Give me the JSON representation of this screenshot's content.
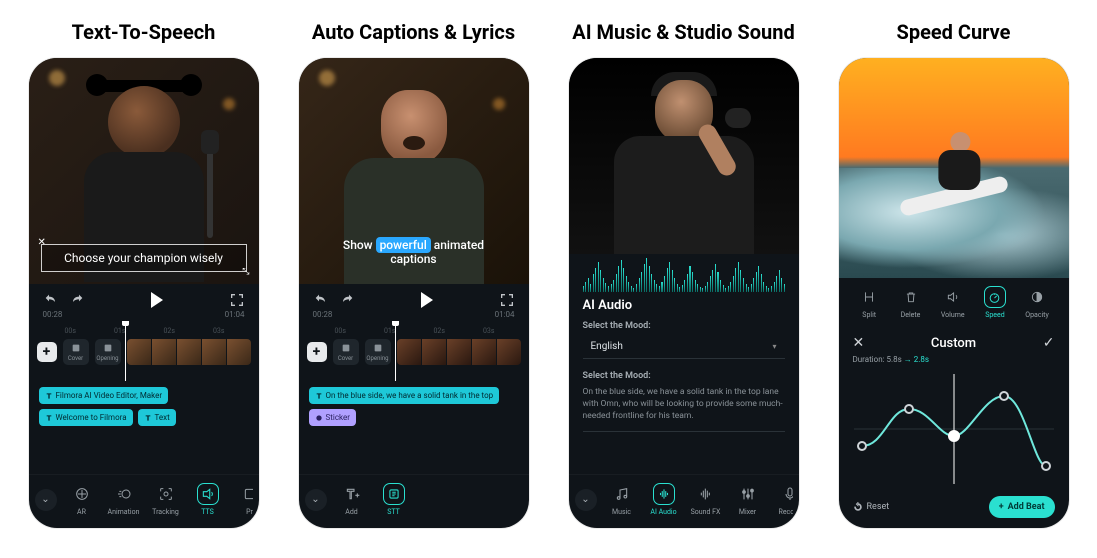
{
  "panels": [
    {
      "title": "Text-To-Speech"
    },
    {
      "title": "Auto Captions & Lyrics"
    },
    {
      "title": "AI Music & Studio Sound"
    },
    {
      "title": "Speed Curve"
    }
  ],
  "phone1": {
    "caption": "Choose your champion wisely",
    "time_left": "00:28",
    "time_right": "01:04",
    "ruler": [
      "00s",
      "01s",
      "02s",
      "03s"
    ],
    "track_tool1": "Cover",
    "track_tool2": "Opening",
    "tags": [
      {
        "style": "cyan",
        "text": "Filmora AI Video Editor, Maker"
      },
      {
        "style": "cyan",
        "text": "Welcome to Filmora"
      },
      {
        "style": "cyan",
        "text": "Text"
      }
    ],
    "tools": [
      {
        "label": "AR",
        "icon": "sparkle"
      },
      {
        "label": "Animation",
        "icon": "motion"
      },
      {
        "label": "Tracking",
        "icon": "target"
      },
      {
        "label": "TTS",
        "icon": "tts",
        "active": true
      },
      {
        "label": "Pr",
        "icon": "box"
      }
    ]
  },
  "phone2": {
    "caption_pre": "Show ",
    "caption_hl": "powerful",
    "caption_post": " animated captions",
    "time_left": "00:28",
    "time_right": "01:04",
    "ruler": [
      "00s",
      "01s",
      "02s",
      "03s"
    ],
    "track_tool1": "Cover",
    "track_tool2": "Opening",
    "tags": [
      {
        "style": "cyan",
        "text": "On the blue side, we have a solid tank in the top"
      },
      {
        "style": "purple",
        "text": "Sticker"
      }
    ],
    "tools": [
      {
        "label": "Add",
        "icon": "textadd"
      },
      {
        "label": "STT",
        "icon": "stt",
        "active": true
      }
    ]
  },
  "phone3": {
    "section": "AI Audio",
    "label1": "Select the Mood:",
    "select1": "English",
    "label2": "Select the Mood:",
    "desc": "On the blue side, we have a solid tank in the top lane with Omn, who will be looking to provide some much-needed frontline for his team.",
    "tools": [
      {
        "label": "Music",
        "icon": "music"
      },
      {
        "label": "AI Audio",
        "icon": "aiaudio",
        "active": true
      },
      {
        "label": "Sound FX",
        "icon": "soundfx"
      },
      {
        "label": "Mixer",
        "icon": "mixer"
      },
      {
        "label": "Record",
        "icon": "mic"
      }
    ]
  },
  "phone4": {
    "icons": [
      {
        "label": "Split",
        "icon": "split"
      },
      {
        "label": "Delete",
        "icon": "trash"
      },
      {
        "label": "Volume",
        "icon": "volume"
      },
      {
        "label": "Speed",
        "icon": "speed",
        "active": true
      },
      {
        "label": "Opacity",
        "icon": "opacity"
      }
    ],
    "title": "Custom",
    "duration_from": "Duration: 5.8s",
    "duration_to": "2.8s",
    "reset": "Reset",
    "addbeat": "Add Beat"
  }
}
